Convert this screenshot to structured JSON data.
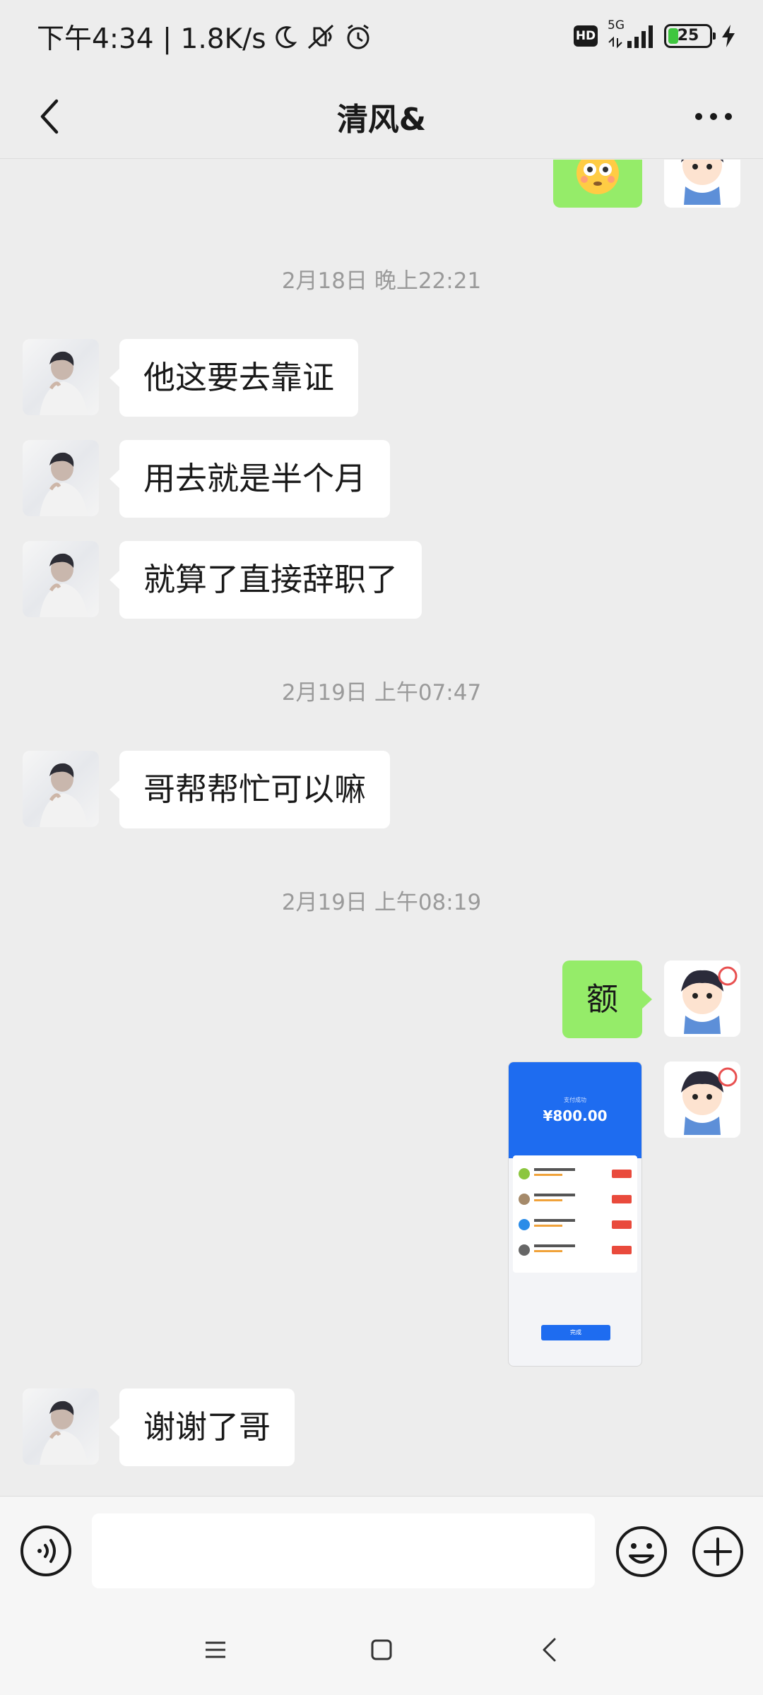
{
  "status_bar": {
    "time_speed": "下午4:34 | 1.8K/s",
    "hd_badge": "HD",
    "network_type": "5G",
    "battery_level": "25"
  },
  "nav": {
    "title": "清风&"
  },
  "messages": [
    {
      "type": "time",
      "text": "2月18日 晚上22:21"
    },
    {
      "type": "text",
      "from": "friend",
      "text": "他这要去靠证"
    },
    {
      "type": "text",
      "from": "friend",
      "text": "用去就是半个月"
    },
    {
      "type": "text",
      "from": "friend",
      "text": "就算了直接辞职了"
    },
    {
      "type": "time",
      "text": "2月19日 上午07:47"
    },
    {
      "type": "text",
      "from": "friend",
      "text": "哥帮帮忙可以嘛"
    },
    {
      "type": "time",
      "text": "2月19日 上午08:19"
    },
    {
      "type": "text",
      "from": "self",
      "text": "额"
    },
    {
      "type": "image",
      "from": "self",
      "caption": "支付成功",
      "amount": "¥800.00",
      "button": "完成"
    },
    {
      "type": "text",
      "from": "friend",
      "text": "谢谢了哥"
    }
  ],
  "colors": {
    "chat_background": "#ededed",
    "self_bubble": "#95ec69",
    "friend_bubble": "#ffffff",
    "timestamp": "#9a9a9a"
  },
  "icons": {
    "back": "chevron-left-icon",
    "more": "more-dots-icon",
    "voice": "voice-icon",
    "emoji": "emoji-icon",
    "plus": "plus-icon"
  }
}
